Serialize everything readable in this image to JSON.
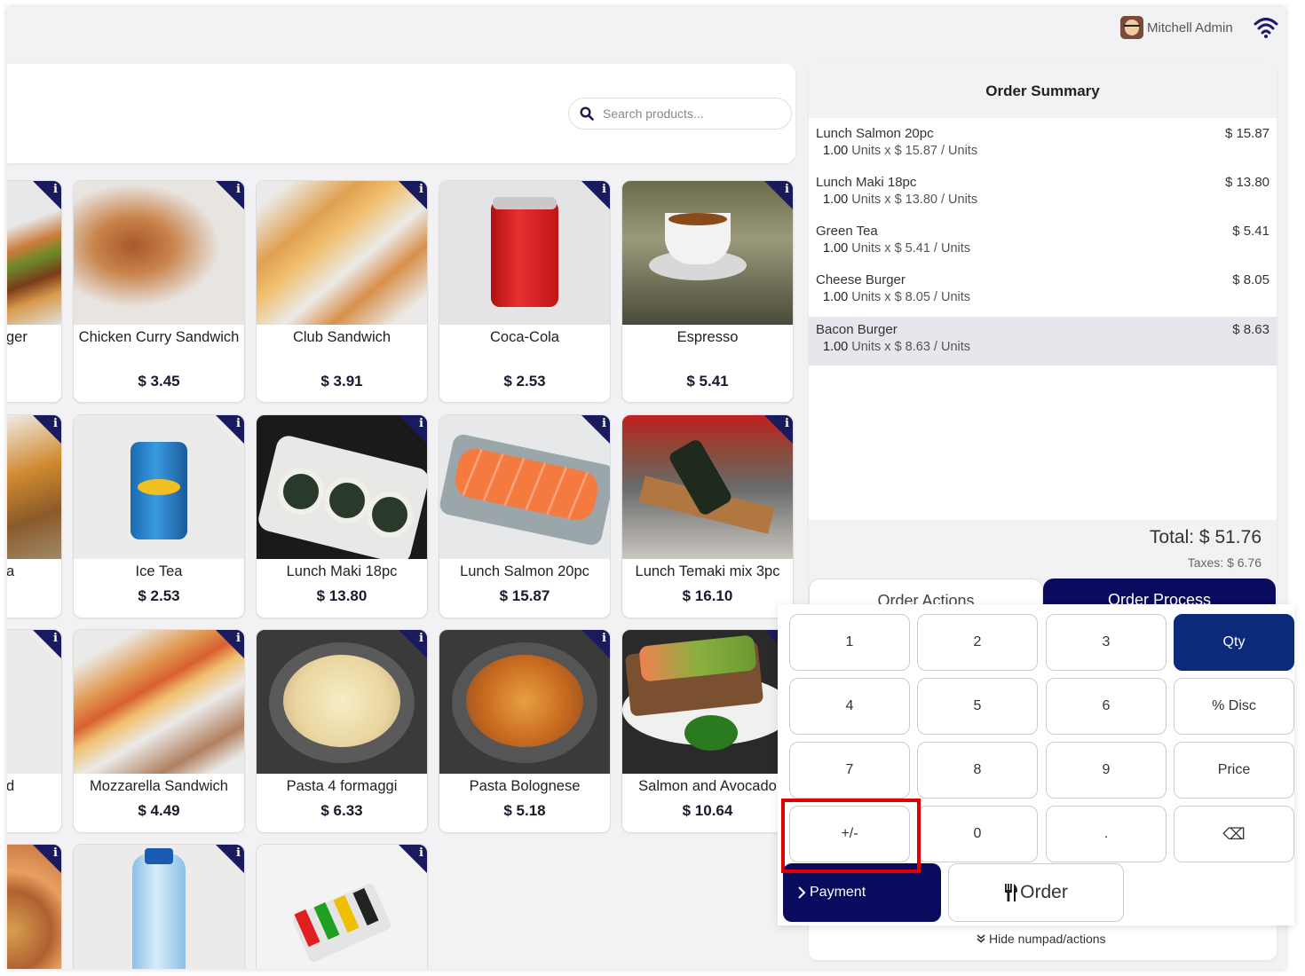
{
  "header": {
    "user_name": "Mitchell Admin",
    "user_avatar_icon": "avatar-icon",
    "network_icon": "wifi-icon"
  },
  "search": {
    "placeholder": "Search products...",
    "icon": "search-icon"
  },
  "products": [
    {
      "name": "ger",
      "price": ""
    },
    {
      "name": "Chicken Curry Sandwich",
      "price": "$ 3.45"
    },
    {
      "name": "Club Sandwich",
      "price": "$ 3.91"
    },
    {
      "name": "Coca-Cola",
      "price": "$ 2.53"
    },
    {
      "name": "Espresso",
      "price": "$ 5.41"
    },
    {
      "name": "a",
      "price": ""
    },
    {
      "name": "Ice Tea",
      "price": "$ 2.53"
    },
    {
      "name": "Lunch Maki 18pc",
      "price": "$ 13.80"
    },
    {
      "name": "Lunch Salmon 20pc",
      "price": "$ 15.87"
    },
    {
      "name": "Lunch Temaki mix 3pc",
      "price": "$ 16.10"
    },
    {
      "name": "d",
      "price": ""
    },
    {
      "name": "Mozzarella Sandwich",
      "price": "$ 4.49"
    },
    {
      "name": "Pasta 4 formaggi",
      "price": "$ 6.33"
    },
    {
      "name": "Pasta Bolognese",
      "price": "$ 5.18"
    },
    {
      "name": "Salmon and Avocado",
      "price": "$ 10.64"
    },
    {
      "name": "",
      "price": ""
    },
    {
      "name": "",
      "price": ""
    },
    {
      "name": "",
      "price": ""
    }
  ],
  "order": {
    "title": "Order Summary",
    "lines": [
      {
        "name": "Lunch Salmon 20pc",
        "qty": "1.00",
        "detail": "Units x $ 15.87 / Units",
        "price": "$ 15.87",
        "selected": false
      },
      {
        "name": "Lunch Maki 18pc",
        "qty": "1.00",
        "detail": "Units x $ 13.80 / Units",
        "price": "$ 13.80",
        "selected": false
      },
      {
        "name": "Green Tea",
        "qty": "1.00",
        "detail": "Units x $ 5.41 / Units",
        "price": "$ 5.41",
        "selected": false
      },
      {
        "name": "Cheese Burger",
        "qty": "1.00",
        "detail": "Units x $ 8.05 / Units",
        "price": "$ 8.05",
        "selected": false
      },
      {
        "name": "Bacon Burger",
        "qty": "1.00",
        "detail": "Units x $ 8.63 / Units",
        "price": "$ 8.63",
        "selected": true
      }
    ],
    "total": "Total: $ 51.76",
    "taxes": "Taxes: $ 6.76"
  },
  "tabs": {
    "actions": "Order Actions",
    "process": "Order Process"
  },
  "numpad": {
    "keys": [
      "1",
      "2",
      "3",
      "Qty",
      "4",
      "5",
      "6",
      "% Disc",
      "7",
      "8",
      "9",
      "Price",
      "+/-",
      "0",
      ".",
      "⌫"
    ],
    "active_mode": "Qty",
    "payment": "Payment",
    "order": "Order",
    "hide": "Hide numpad/actions"
  },
  "colors": {
    "primary": "#0a0a5e",
    "qty_active": "#0c2a7a",
    "highlight": "#e00000"
  }
}
